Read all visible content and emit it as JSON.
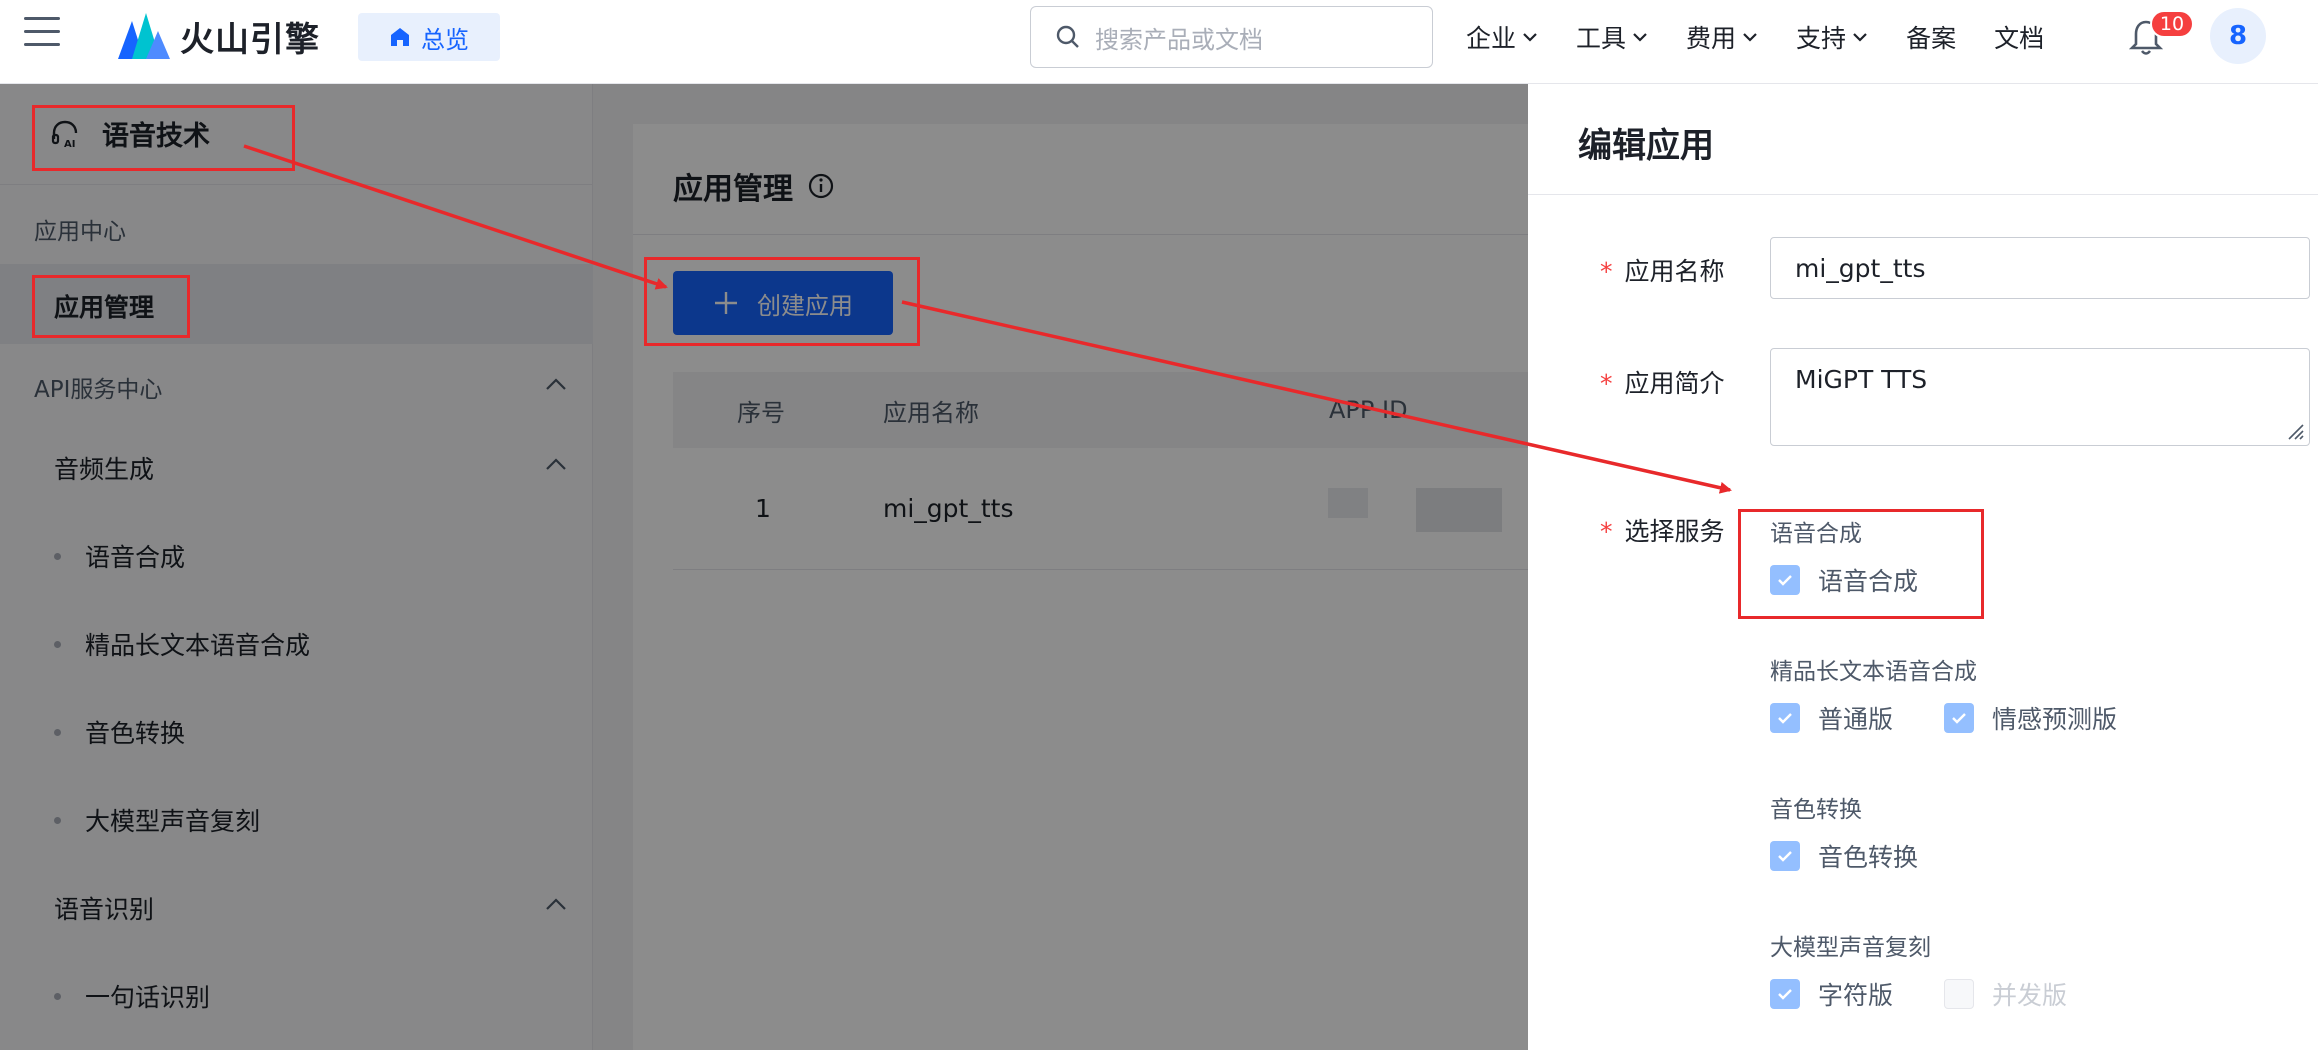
{
  "header": {
    "logo_name": "火山引擎",
    "overview_label": "总览",
    "search_placeholder": "搜索产品或文档",
    "nav": [
      {
        "label": "企业",
        "dropdown": true
      },
      {
        "label": "工具",
        "dropdown": true
      },
      {
        "label": "费用",
        "dropdown": true
      },
      {
        "label": "支持",
        "dropdown": true
      },
      {
        "label": "备案",
        "dropdown": false
      },
      {
        "label": "文档",
        "dropdown": false
      }
    ],
    "notification_count": "10",
    "avatar_text": "8"
  },
  "sidebar": {
    "product_title": "语音技术",
    "app_center_label": "应用中心",
    "app_manage_label": "应用管理",
    "api_center_label": "API服务中心",
    "audio_gen_label": "音频生成",
    "audio_gen_items": [
      "语音合成",
      "精品长文本语音合成",
      "音色转换",
      "大模型声音复刻"
    ],
    "asr_label": "语音识别",
    "asr_items": [
      "一句话识别"
    ]
  },
  "main": {
    "page_title": "应用管理",
    "create_button_label": "创建应用",
    "table": {
      "headers": [
        "序号",
        "应用名称",
        "APP ID"
      ],
      "rows": [
        {
          "index": "1",
          "name": "mi_gpt_tts"
        }
      ]
    }
  },
  "drawer": {
    "title": "编辑应用",
    "name_label": "应用名称",
    "name_value": "mi_gpt_tts",
    "desc_label": "应用简介",
    "desc_value": "MiGPT TTS",
    "service_label": "选择服务",
    "services": [
      {
        "group": "语音合成",
        "options": [
          {
            "label": "语音合成",
            "checked": true
          }
        ]
      },
      {
        "group": "精品长文本语音合成",
        "options": [
          {
            "label": "普通版",
            "checked": true
          },
          {
            "label": "情感预测版",
            "checked": true
          }
        ]
      },
      {
        "group": "音色转换",
        "options": [
          {
            "label": "音色转换",
            "checked": true
          }
        ]
      },
      {
        "group": "大模型声音复刻",
        "options": [
          {
            "label": "字符版",
            "checked": true
          },
          {
            "label": "并发版",
            "checked": false
          }
        ]
      }
    ]
  },
  "colors": {
    "brand": "#1664ff",
    "annotation": "#e8292b",
    "badge": "#f53f3f",
    "checkbox_checked": "#94bfff"
  }
}
